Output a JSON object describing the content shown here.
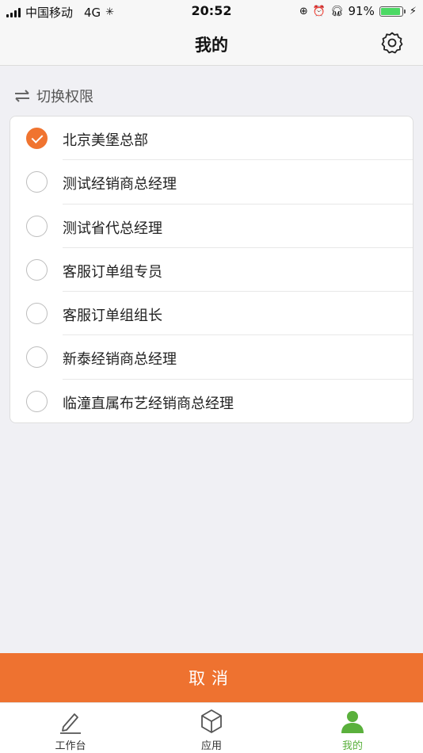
{
  "status_bar": {
    "carrier": "中国移动",
    "network": "4G",
    "time": "20:52",
    "battery_percent": "91%",
    "battery_level": 0.91
  },
  "header": {
    "title": "我的",
    "settings_icon": "gear-icon"
  },
  "section": {
    "title": "切换权限",
    "icon": "swap-arrows-icon"
  },
  "roles": [
    {
      "label": "北京美堡总部",
      "selected": true
    },
    {
      "label": "测试经销商总经理",
      "selected": false
    },
    {
      "label": "测试省代总经理",
      "selected": false
    },
    {
      "label": "客服订单组专员",
      "selected": false
    },
    {
      "label": "客服订单组组长",
      "selected": false
    },
    {
      "label": "新泰经销商总经理",
      "selected": false
    },
    {
      "label": "临潼直属布艺经销商总经理",
      "selected": false
    }
  ],
  "cancel_button": "取消",
  "tabbar": {
    "tabs": [
      {
        "label": "工作台",
        "icon": "pen-icon",
        "active": false
      },
      {
        "label": "应用",
        "icon": "cube-icon",
        "active": false
      },
      {
        "label": "我的",
        "icon": "person-icon",
        "active": true
      }
    ]
  },
  "colors": {
    "accent": "#ee7230",
    "active_tab": "#5ab03c",
    "battery": "#4cd964"
  }
}
